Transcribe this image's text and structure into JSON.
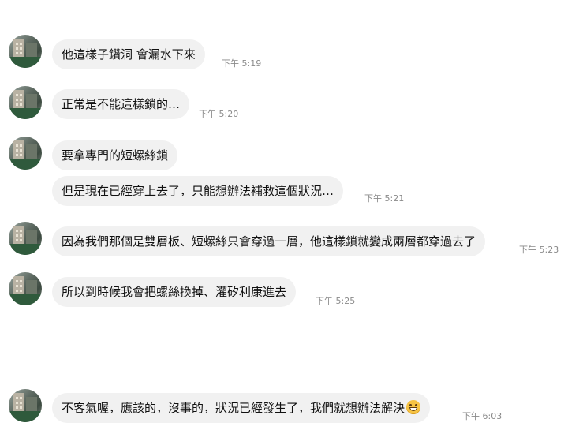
{
  "messages": [
    {
      "text": "他這樣子鑽洞 會漏水下來",
      "time": "下午 5:19"
    },
    {
      "text": "正常是不能這樣鎖的…",
      "time": "下午 5:20"
    },
    {
      "text": "要拿專門的短螺絲鎖",
      "time": ""
    },
    {
      "text": "但是現在已經穿上去了，只能想辦法補救這個狀況…",
      "time": "下午 5:21"
    },
    {
      "text": "因為我們那個是雙層板、短螺絲只會穿過一層，他這樣鎖就變成兩層都穿過去了",
      "time": "下午 5:23"
    },
    {
      "text": "所以到時候我會把螺絲換掉、灌矽利康進去",
      "time": "下午 5:25"
    },
    {
      "text": "不客氣喔，應該的，沒事的，狀況已經發生了，我們就想辦法解決",
      "time": "下午 6:03"
    }
  ],
  "emoji": "grinning-face-emoji"
}
